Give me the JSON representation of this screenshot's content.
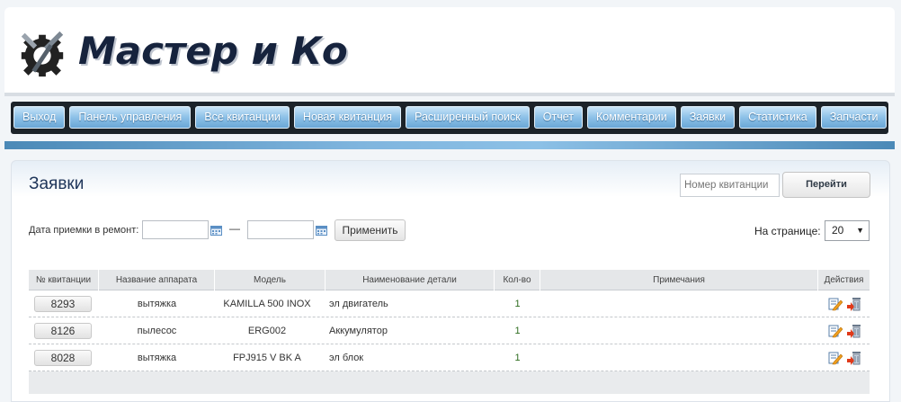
{
  "header": {
    "logo_text": "Мастер и Ко"
  },
  "nav": {
    "items": [
      {
        "label": "Выход"
      },
      {
        "label": "Панель управления"
      },
      {
        "label": "Все квитанции"
      },
      {
        "label": "Новая квитанция"
      },
      {
        "label": "Расширенный поиск"
      },
      {
        "label": "Отчет"
      },
      {
        "label": "Комментарии"
      },
      {
        "label": "Заявки"
      },
      {
        "label": "Статистика"
      },
      {
        "label": "Запчасти"
      }
    ]
  },
  "page": {
    "title": "Заявки",
    "search_placeholder": "Номер квитанции",
    "go_label": "Перейти"
  },
  "filter": {
    "label": "Дата приемки в ремонт:",
    "dash": "—",
    "from_value": "",
    "to_value": "",
    "apply_label": "Применить",
    "perpage_label": "На странице:",
    "perpage_value": "20"
  },
  "table": {
    "columns": [
      "№ квитанции",
      "Название аппарата",
      "Модель",
      "Наименование детали",
      "Кол-во",
      "Примечания",
      "Действия"
    ],
    "rows": [
      {
        "ticket": "8293",
        "device": "вытяжка",
        "model": "KAMILLA 500 INOX",
        "part": "эл двигатель",
        "qty": "1",
        "notes": ""
      },
      {
        "ticket": "8126",
        "device": "пылесос",
        "model": "ERG002",
        "part": "Аккумулятор",
        "qty": "1",
        "notes": ""
      },
      {
        "ticket": "8028",
        "device": "вытяжка",
        "model": "FPJ915 V BK A",
        "part": "эл блок",
        "qty": "1",
        "notes": ""
      }
    ]
  }
}
